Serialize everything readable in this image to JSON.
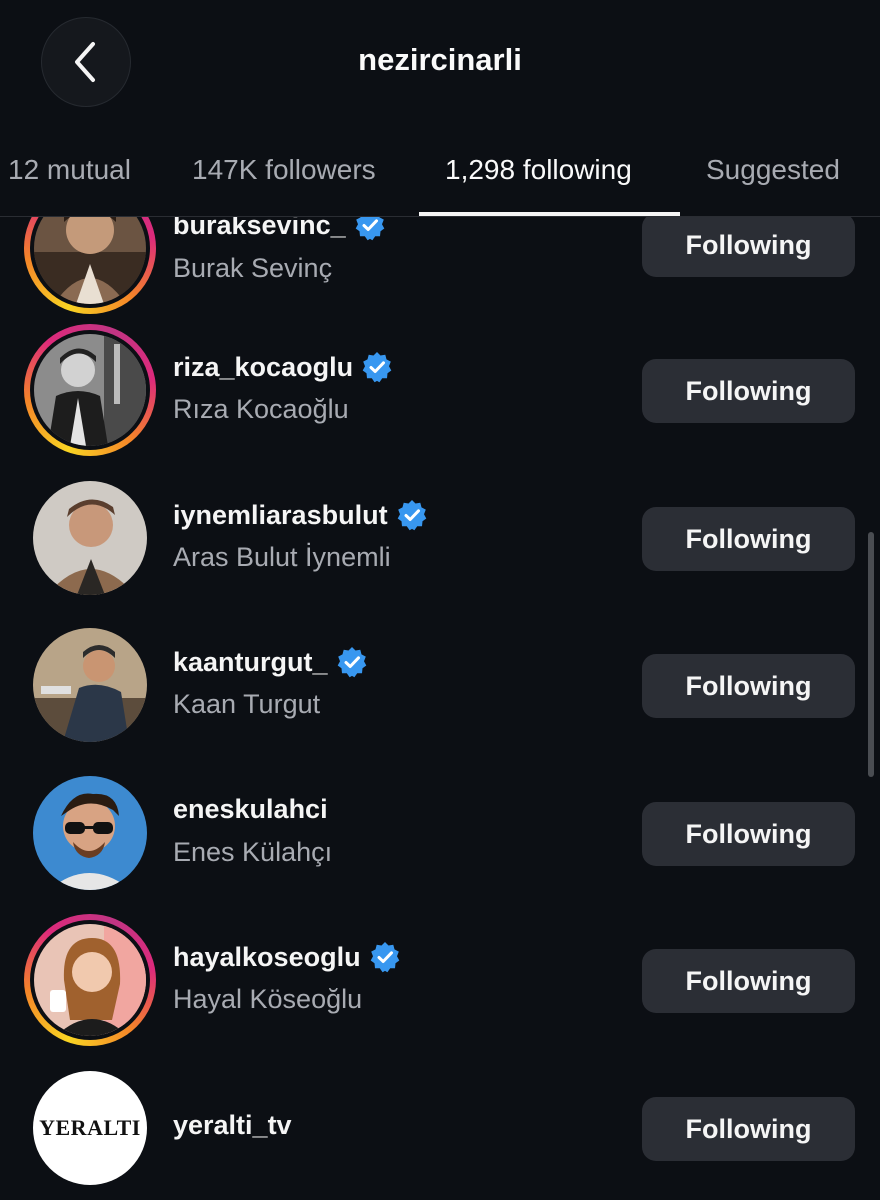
{
  "header": {
    "title": "nezircinarli",
    "back_icon": "chevron-left-icon"
  },
  "tabs": [
    {
      "label": "12 mutual",
      "active": false
    },
    {
      "label": "147K followers",
      "active": false
    },
    {
      "label": "1,298 following",
      "active": true
    },
    {
      "label": "Suggested",
      "active": false
    }
  ],
  "colors": {
    "background": "#0c0f14",
    "button": "#2b2e35",
    "verified": "#3897f0",
    "secondary_text": "#a8abb2"
  },
  "accounts": [
    {
      "username": "buraksevinc_",
      "full_name": "Burak Sevinç",
      "verified": true,
      "story_ring": true,
      "button_label": "Following"
    },
    {
      "username": "riza_kocaoglu",
      "full_name": "Rıza Kocaoğlu",
      "verified": true,
      "story_ring": true,
      "button_label": "Following"
    },
    {
      "username": "iynemliarasbulut",
      "full_name": "Aras Bulut İynemli",
      "verified": true,
      "story_ring": false,
      "button_label": "Following"
    },
    {
      "username": "kaanturgut_",
      "full_name": "Kaan Turgut",
      "verified": true,
      "story_ring": false,
      "button_label": "Following"
    },
    {
      "username": "eneskulahci",
      "full_name": "Enes Külahçı",
      "verified": false,
      "story_ring": false,
      "button_label": "Following"
    },
    {
      "username": "hayalkoseoglu",
      "full_name": "Hayal Köseoğlu",
      "verified": true,
      "story_ring": true,
      "button_label": "Following"
    },
    {
      "username": "yeralti_tv",
      "full_name": "",
      "verified": false,
      "story_ring": false,
      "button_label": "Following",
      "logo_text": "YERALTI"
    }
  ]
}
